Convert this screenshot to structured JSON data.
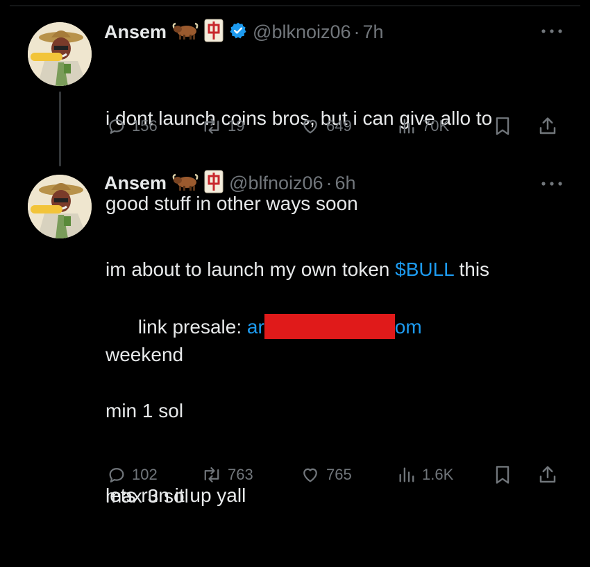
{
  "colors": {
    "background": "#000000",
    "text": "#e7e9ea",
    "muted": "#71767b",
    "link": "#1d9bf0",
    "verified": "#1d9bf0",
    "redaction": "#e01a1a",
    "mahjong_red": "#c8282c"
  },
  "tweets": [
    {
      "name": "Ansem",
      "badges": [
        "ox-emoji",
        "mahjong-red-dragon",
        "verified-badge"
      ],
      "handle": "@blknoiz06",
      "time": "7h",
      "text_line1": "i dont launch coins bros, but i can give allo to",
      "text_line2": "good stuff in other ways soon",
      "replies": "156",
      "retweets": "19",
      "likes": "649",
      "views": "70K"
    },
    {
      "name": "Ansem",
      "badges": [
        "ox-emoji",
        "mahjong-red-dragon"
      ],
      "handle": "@blfnoiz06",
      "time": "6h",
      "text_before_ticker": "im about to launch my own token ",
      "ticker": "$BULL",
      "text_after_ticker": " this",
      "text_line2": "weekend",
      "presale_label": "link presale: ",
      "presale_link_start": "ar",
      "presale_link_end": "om",
      "min": "min 1 sol",
      "max": "max 3 sol",
      "closing": "lets run it up yall",
      "replies": "102",
      "retweets": "763",
      "likes": "765",
      "views": "1.6K"
    }
  ],
  "separator": "·"
}
